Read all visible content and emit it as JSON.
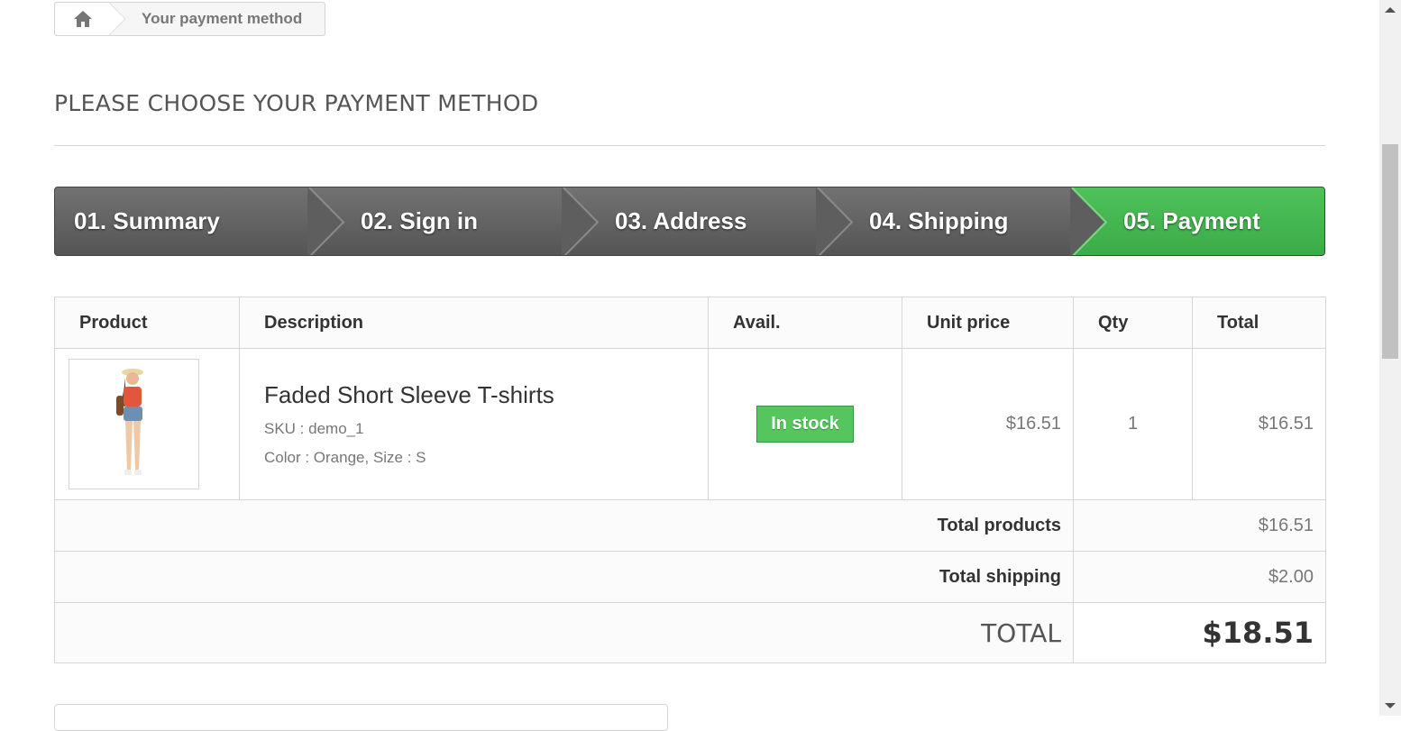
{
  "breadcrumb": {
    "home_icon": "home-icon",
    "current": "Your payment method"
  },
  "heading": "PLEASE CHOOSE YOUR PAYMENT METHOD",
  "steps": [
    {
      "label": "01. Summary",
      "state": "done"
    },
    {
      "label": "02. Sign in",
      "state": "done"
    },
    {
      "label": "03. Address",
      "state": "done"
    },
    {
      "label": "04. Shipping",
      "state": "done"
    },
    {
      "label": "05. Payment",
      "state": "current"
    }
  ],
  "colors": {
    "step_done": "#636363",
    "step_current": "#46b853",
    "in_stock": "#55c65e"
  },
  "cart": {
    "headers": {
      "product": "Product",
      "description": "Description",
      "avail": "Avail.",
      "unit_price": "Unit price",
      "qty": "Qty",
      "total": "Total"
    },
    "item": {
      "name": "Faded Short Sleeve T-shirts",
      "sku": "SKU : demo_1",
      "attributes": "Color : Orange, Size : S",
      "availability": "In stock",
      "unit_price": "$16.51",
      "qty": "1",
      "total": "$16.51"
    },
    "totals": {
      "products_label": "Total products",
      "products_value": "$16.51",
      "shipping_label": "Total shipping",
      "shipping_value": "$2.00",
      "grand_label": "TOTAL",
      "grand_value": "$18.51"
    }
  }
}
